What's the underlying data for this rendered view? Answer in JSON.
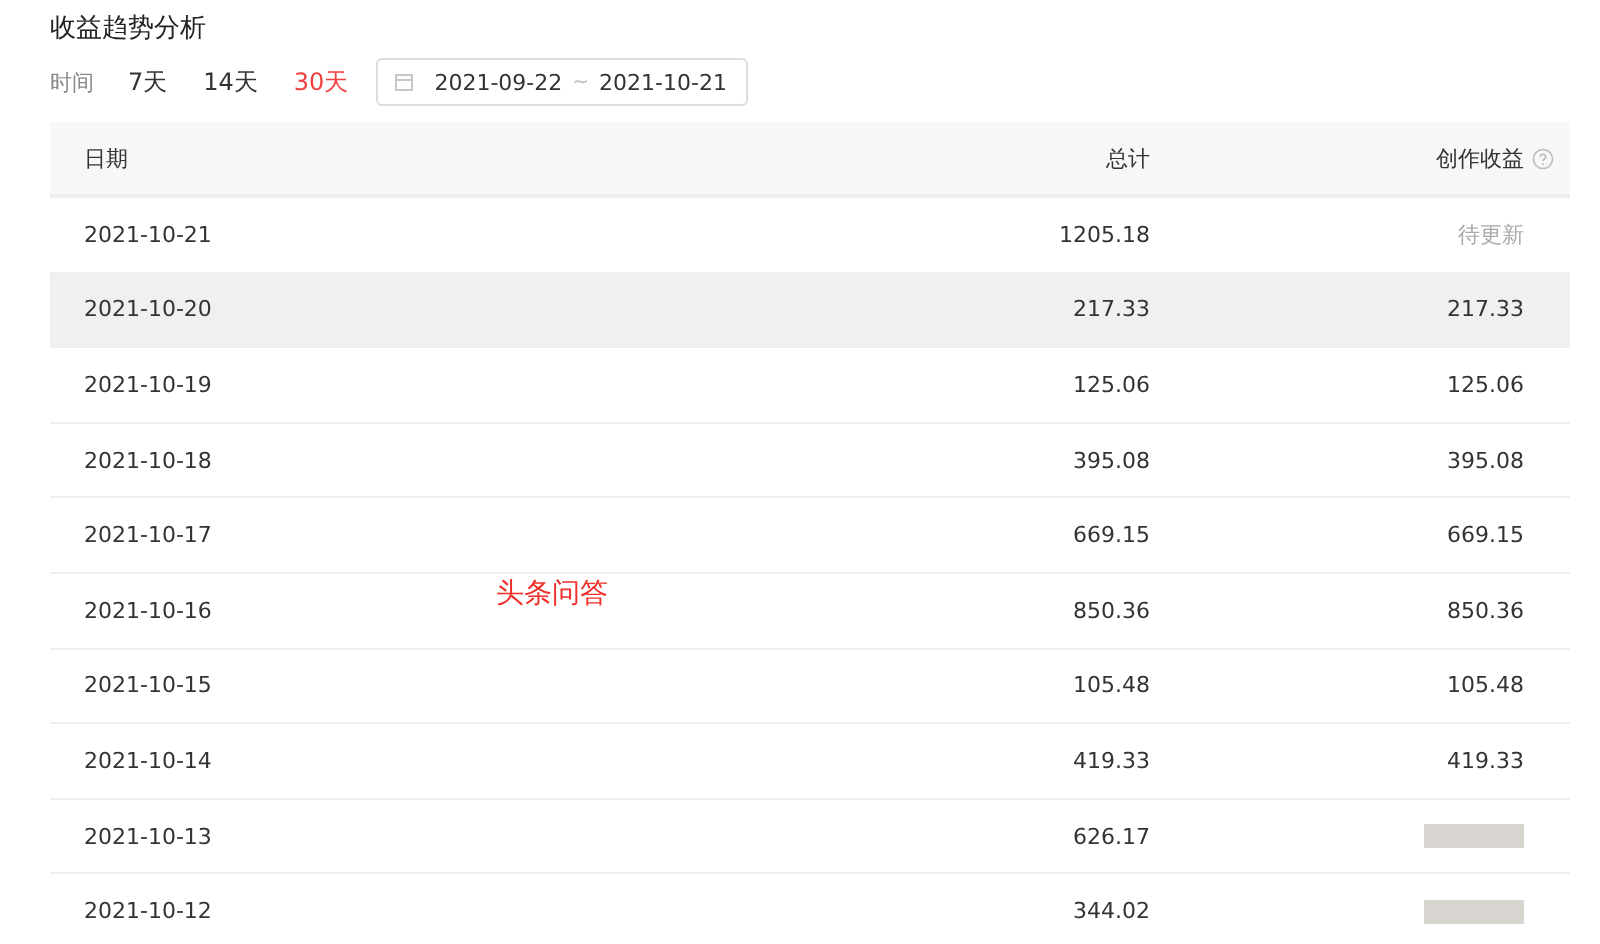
{
  "title": "收益趋势分析",
  "filter": {
    "label": "时间",
    "ranges": [
      {
        "label": "7天",
        "selected": false
      },
      {
        "label": "14天",
        "selected": false
      },
      {
        "label": "30天",
        "selected": true
      }
    ],
    "date_range": {
      "start": "2021-09-22",
      "separator": "~",
      "end": "2021-10-21"
    }
  },
  "table": {
    "columns": [
      {
        "label": "日期"
      },
      {
        "label": "总计"
      },
      {
        "label": "创作收益",
        "help": true
      }
    ],
    "rows": [
      {
        "date": "2021-10-21",
        "total": "1205.18",
        "income": {
          "kind": "status",
          "text": "待更新"
        },
        "highlighted": false
      },
      {
        "date": "2021-10-20",
        "total": "217.33",
        "income": {
          "kind": "amount",
          "text": "217.33"
        },
        "highlighted": true
      },
      {
        "date": "2021-10-19",
        "total": "125.06",
        "income": {
          "kind": "amount",
          "text": "125.06"
        },
        "highlighted": false
      },
      {
        "date": "2021-10-18",
        "total": "395.08",
        "income": {
          "kind": "amount",
          "text": "395.08"
        },
        "highlighted": false
      },
      {
        "date": "2021-10-17",
        "total": "669.15",
        "income": {
          "kind": "amount",
          "text": "669.15"
        },
        "highlighted": false
      },
      {
        "date": "2021-10-16",
        "total": "850.36",
        "income": {
          "kind": "amount",
          "text": "850.36"
        },
        "highlighted": false
      },
      {
        "date": "2021-10-15",
        "total": "105.48",
        "income": {
          "kind": "amount",
          "text": "105.48"
        },
        "highlighted": false
      },
      {
        "date": "2021-10-14",
        "total": "419.33",
        "income": {
          "kind": "amount",
          "text": "419.33"
        },
        "highlighted": false
      },
      {
        "date": "2021-10-13",
        "total": "626.17",
        "income": {
          "kind": "obscured"
        },
        "highlighted": false
      },
      {
        "date": "2021-10-12",
        "total": "344.02",
        "income": {
          "kind": "obscured"
        },
        "highlighted": false
      }
    ]
  },
  "annotation": "头条问答"
}
